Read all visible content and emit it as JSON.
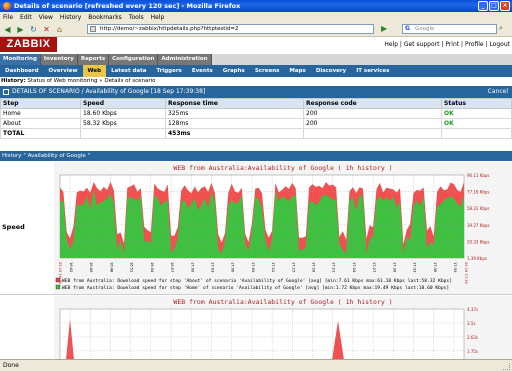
{
  "window": {
    "title": "Details of scenario [refreshed every 120 sec] - Mozilla Firefox"
  },
  "menubar": [
    "File",
    "Edit",
    "View",
    "History",
    "Bookmarks",
    "Tools",
    "Help"
  ],
  "toolbar": {
    "url": "http://demo/~zabbix/httpdetails.php?httptestid=2",
    "search_placeholder": "Google"
  },
  "zabbix": {
    "logo": "ZABBIX",
    "top_links": "Help | Get support | Print | Profile | Logout",
    "main_menu": [
      {
        "label": "Monitoring",
        "active": true
      },
      {
        "label": "Inventory",
        "active": false
      },
      {
        "label": "Reports",
        "active": false
      },
      {
        "label": "Configuration",
        "active": false
      },
      {
        "label": "Administration",
        "active": false
      }
    ],
    "sub_menu": [
      {
        "label": "Dashboard",
        "active": false
      },
      {
        "label": "Overview",
        "active": false
      },
      {
        "label": "Web",
        "active": true
      },
      {
        "label": "Latest data",
        "active": false
      },
      {
        "label": "Triggers",
        "active": false
      },
      {
        "label": "Events",
        "active": false
      },
      {
        "label": "Graphs",
        "active": false
      },
      {
        "label": "Screens",
        "active": false
      },
      {
        "label": "Maps",
        "active": false
      },
      {
        "label": "Discovery",
        "active": false
      },
      {
        "label": "IT services",
        "active": false
      }
    ],
    "history_label": "History:",
    "history_path": "Status of Web monitoring » Details of scenario",
    "scenario_header": "DETAILS OF SCENARIO / Availability of Google",
    "scenario_time": "[18 Sep 17:39:38]",
    "cancel": "Cancel",
    "steps_table": {
      "headers": [
        "Step",
        "Speed",
        "Response time",
        "Response code",
        "Status"
      ],
      "rows": [
        [
          "Home",
          "18.60 Kbps",
          "325ms",
          "200",
          "OK"
        ],
        [
          "About",
          "58.32 Kbps",
          "128ms",
          "200",
          "OK"
        ]
      ],
      "total_label": "TOTAL",
      "total_time": "453ms"
    },
    "history_section": "History \" Availability of Google \"",
    "graph_speed_label": "Speed"
  },
  "graph1": {
    "title": "WEB from Australia:Availability of Google ( 1h history )",
    "y_ticks": [
      "96.11 Kbps",
      "77.16 Kbps",
      "58.22 Kbps",
      "39.27 Kbps",
      "20.33 Kbps",
      "1.39 Kbps"
    ],
    "x_ticks": [
      "16:42",
      "16:45",
      "16:48",
      "16:51",
      "16:54",
      "16:57",
      "17:00",
      "17:03",
      "17:06",
      "17:09",
      "17:12",
      "17:15",
      "17:18",
      "17:21",
      "17:24",
      "17:27",
      "17:30",
      "17:33",
      "17:36",
      "17:39"
    ],
    "legend": [
      {
        "color": "#e84848",
        "text": "WEB from Australia: Download speed for step 'About' of scenario 'Availability of Google' [avg] [min:7.61 Kbps max:61.18 Kbps last:58.32 Kbps]"
      },
      {
        "color": "#40c040",
        "text": "WEB from Australia: Download speed for step 'Home' of scenario 'Availability of Google' [avg] [min:1.72 Kbps max:19.49 Kbps last:18.60 Kbps]"
      }
    ],
    "edge_labels": [
      "09.18 16:39",
      "09.18 17:39"
    ]
  },
  "graph2": {
    "title": "WEB from Australia:Availability of Google ( 1h history )",
    "y_ticks": [
      "4.37s",
      "3.5s",
      "2.63s",
      "1.75s"
    ]
  },
  "statusbar": {
    "text": "Done"
  },
  "colors": {
    "header_blue": "#27669c",
    "logo_red": "#a91111",
    "area_green": "#40c040",
    "area_red": "#f05050"
  }
}
